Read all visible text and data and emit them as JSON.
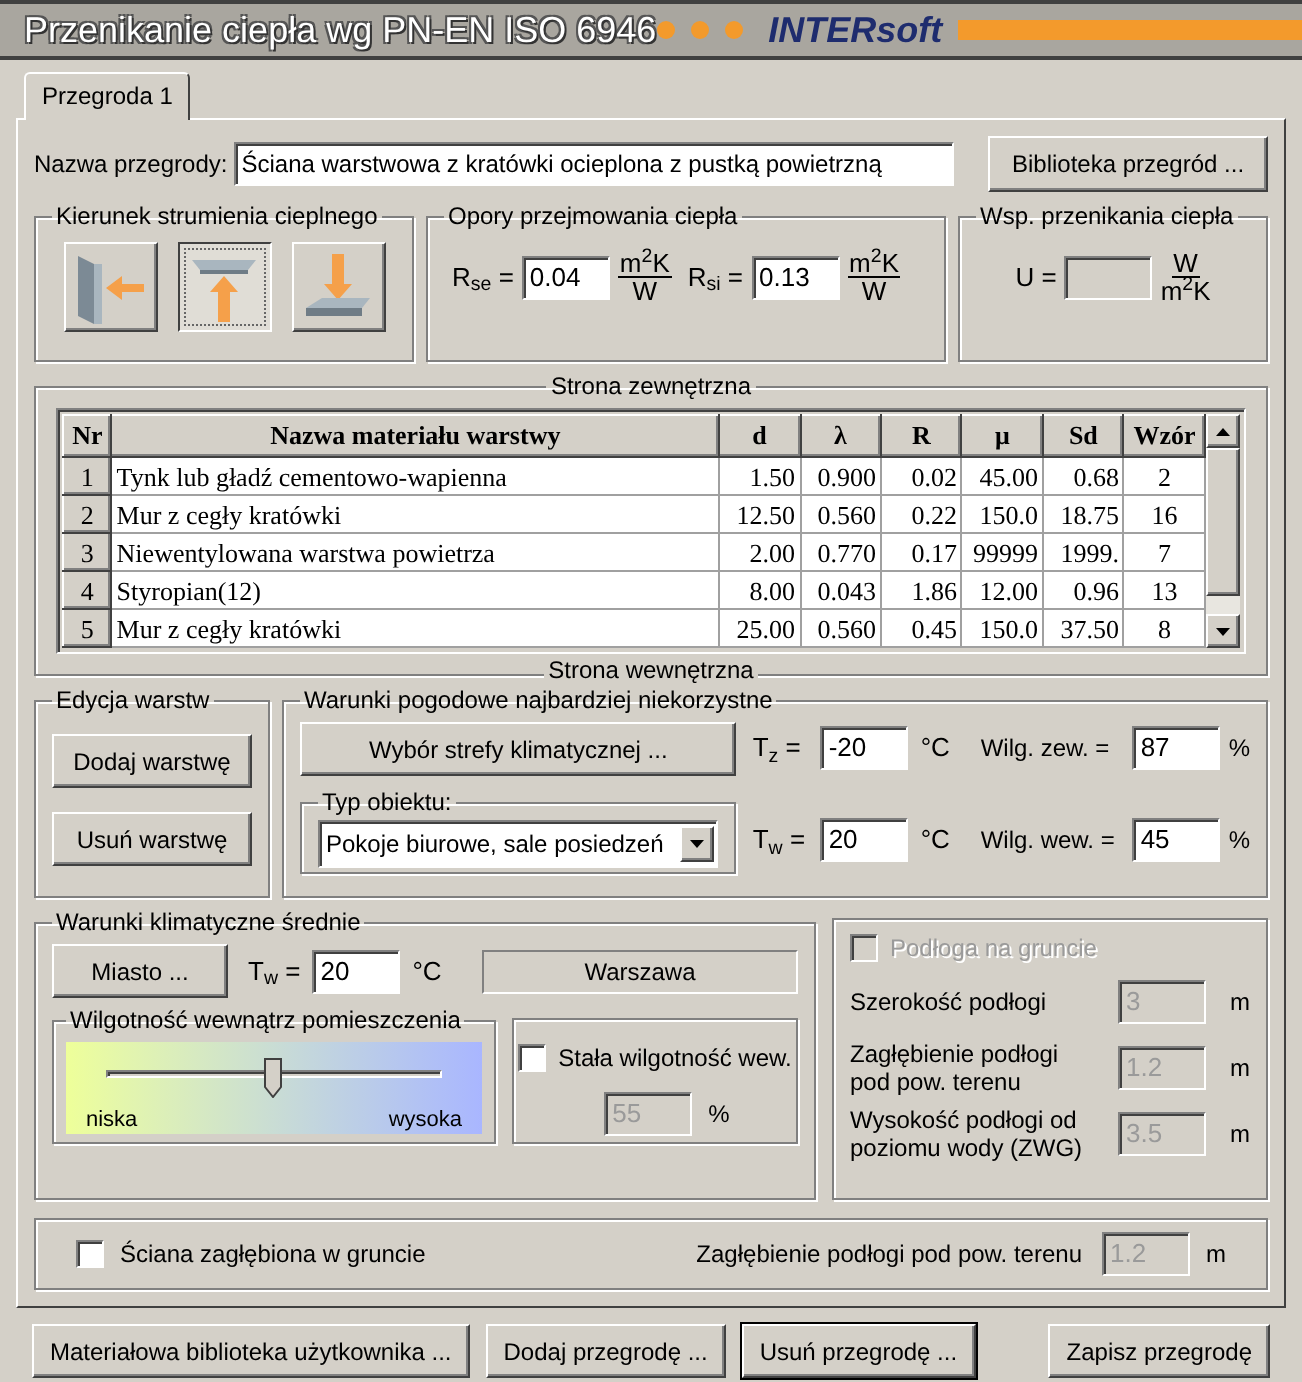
{
  "window": {
    "title": "Przenikanie ciepła wg PN-EN ISO 6946",
    "brand": "INTERsoft"
  },
  "tabs": [
    {
      "label": "Przegroda 1",
      "selected": true
    }
  ],
  "name_field": {
    "label": "Nazwa przegrody:",
    "value": "Ściana warstwowa  z kratówki ocieplona z pustką powietrzną"
  },
  "library_button": "Biblioteka przegród ...",
  "heat_flow": {
    "title": "Kierunek strumienia cieplnego",
    "options": [
      {
        "kind": "horizontal",
        "selected": false
      },
      {
        "kind": "up",
        "selected": true
      },
      {
        "kind": "down",
        "selected": false
      }
    ]
  },
  "resistance": {
    "title": "Opory przejmowania ciepła",
    "fields": [
      {
        "label": "R$_{se}$ =",
        "value": "0.04",
        "unit_top": "m$^{2}$K",
        "unit_bottom": "W"
      },
      {
        "label": "R$_{si}$ =",
        "value": "0.13",
        "unit_top": "m$^{2}$K",
        "unit_bottom": "W"
      }
    ]
  },
  "transmittance": {
    "title": "Wsp. przenikania ciepła",
    "label": "U =",
    "unit_top": "W",
    "unit_bottom": "m$^{2}$K"
  },
  "layers": {
    "title": "Strona zewnętrzna",
    "footer": "Strona wewnętrzna",
    "columns": [
      "Nr",
      "Nazwa materiału warstwy",
      "d",
      "λ",
      "R",
      "μ",
      "Sd",
      "Wzór"
    ],
    "rows": [
      [
        "1",
        "Tynk lub gładź cementowo-wapienna",
        "1.50",
        "0.900",
        "0.02",
        "45.00",
        "0.68",
        "2"
      ],
      [
        "2",
        "Mur z cegły kratówki",
        "12.50",
        "0.560",
        "0.22",
        "150.0",
        "18.75",
        "16"
      ],
      [
        "3",
        "Niewentylowana warstwa powietrza",
        "2.00",
        "0.770",
        "0.17",
        "99999",
        "1999.",
        "7"
      ],
      [
        "4",
        "Styropian(12)",
        "8.00",
        "0.043",
        "1.86",
        "12.00",
        "0.96",
        "13"
      ],
      [
        "5",
        "Mur z cegły kratówki",
        "25.00",
        "0.560",
        "0.45",
        "150.0",
        "37.50",
        "8"
      ]
    ]
  },
  "layer_edit": {
    "title": "Edycja warstw",
    "buttons": [
      "Dodaj warstwę",
      "Usuń warstwę"
    ]
  },
  "worst_conditions": {
    "title": "Warunki pogodowe najbardziej niekorzystne",
    "zone_button": "Wybór strefy klimatycznej ...",
    "object_type": {
      "label": "Typ obiektu:",
      "value": "Pokoje biurowe, sale posiedzeń"
    },
    "fields": [
      {
        "label": "T$_{z}$ =",
        "value": "-20",
        "unit": "°C",
        "humidity_label": "Wilg. zew. =",
        "humidity": "87",
        "humidity_unit": "%"
      },
      {
        "label": "T$_{w}$ =",
        "value": "20",
        "unit": "°C",
        "humidity_label": "Wilg. wew. =",
        "humidity": "45",
        "humidity_unit": "%"
      }
    ]
  },
  "average_conditions": {
    "title": "Warunki klimatyczne średnie",
    "city_button": "Miasto ...",
    "temp_label": "T$_{w}$ =",
    "temp": "20",
    "temp_unit": "°C",
    "city": "Warszawa",
    "humidity": {
      "title": "Wilgotność wewnątrz pomieszczenia",
      "level": 0.5,
      "low": "niska",
      "high": "wysoka"
    },
    "constant": {
      "label": "Stała wilgotność wew.",
      "checked": false,
      "value": "55",
      "unit": "%"
    }
  },
  "ground_floor": {
    "label": "Podłoga na gruncie",
    "checked": false,
    "disabled": true,
    "fields": [
      {
        "label": "Szerokość podłogi",
        "value": "3",
        "unit": "m"
      },
      {
        "label": "Zagłębienie podłogi\npod pow. terenu",
        "value": "1.2",
        "unit": "m"
      },
      {
        "label": "Wysokość podłogi od\npoziomu wody (ZWG)",
        "value": "3.5",
        "unit": "m"
      }
    ]
  },
  "buried_wall": {
    "label": "Ściana zagłębiona w gruncie",
    "checked": false,
    "depth_label": "Zagłębienie podłogi pod pow. terenu",
    "depth": "1.2",
    "unit": "m"
  },
  "buttons": [
    {
      "label": "Materiałowa biblioteka użytkownika ...",
      "focused": false
    },
    {
      "label": "Dodaj przegrodę ...",
      "focused": false
    },
    {
      "label": "Usuń przegrodę ...",
      "focused": true
    },
    {
      "label": "Zapisz przegrodę",
      "focused": false
    }
  ]
}
